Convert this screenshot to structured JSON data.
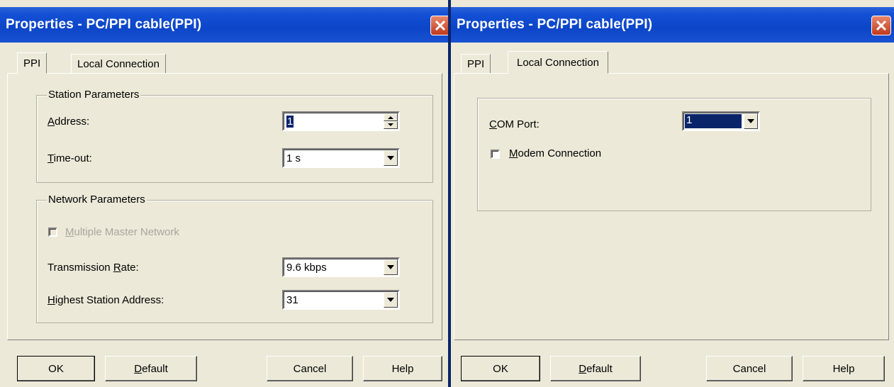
{
  "left_dialog": {
    "title": "Properties - PC/PPI cable(PPI)",
    "tabs": [
      {
        "label": "PPI",
        "active": true
      },
      {
        "label": "Local Connection",
        "active": false
      }
    ],
    "station_group": {
      "legend": "Station Parameters",
      "address_label": "Address:",
      "address_value": "1",
      "timeout_label": "Time-out:",
      "timeout_value": "1 s"
    },
    "network_group": {
      "legend": "Network Parameters",
      "multi_master_label": "Multiple Master Network",
      "multi_master_checked": false,
      "rate_label": "Transmission Rate:",
      "rate_value": "9.6 kbps",
      "highest_label": "Highest Station Address:",
      "highest_value": "31"
    },
    "buttons": {
      "ok": "OK",
      "default": "Default",
      "cancel": "Cancel",
      "help": "Help"
    }
  },
  "right_dialog": {
    "title": "Properties - PC/PPI cable(PPI)",
    "tabs": [
      {
        "label": "PPI",
        "active": false
      },
      {
        "label": "Local Connection",
        "active": true
      }
    ],
    "com_port_label": "COM Port:",
    "com_port_value": "1",
    "modem_label": "Modem Connection",
    "modem_checked": false,
    "buttons": {
      "ok": "OK",
      "default": "Default",
      "cancel": "Cancel",
      "help": "Help"
    }
  },
  "colors": {
    "titlebar": "#0c45c8",
    "face": "#ece9d8",
    "close": "#c0391c",
    "selection": "#0a246a"
  },
  "icons": {
    "close": "close-icon",
    "dropdown": "chevron-down-icon",
    "spin_up": "spin-up-icon",
    "spin_down": "spin-down-icon"
  }
}
